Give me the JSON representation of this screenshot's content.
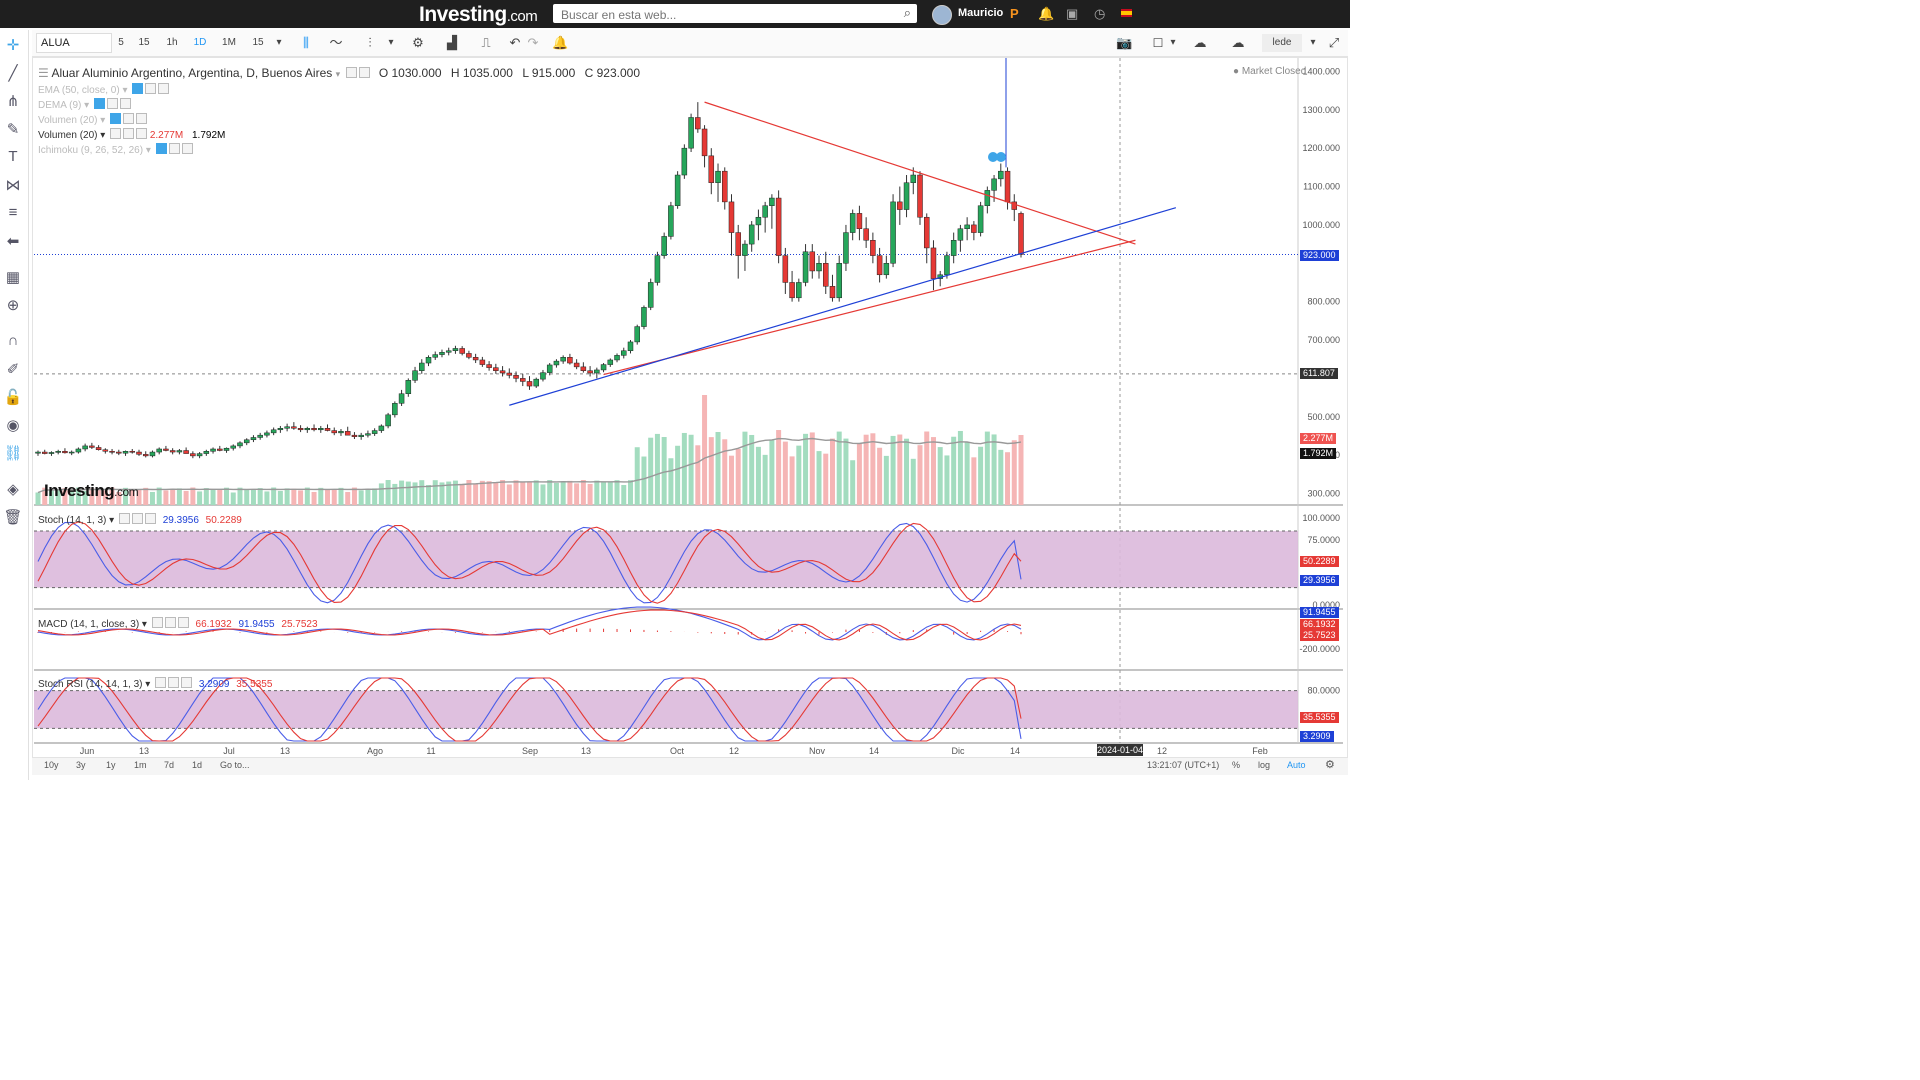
{
  "nav": {
    "logo": "Investing",
    "logo_domain": ".com",
    "search_placeholder": "Buscar en esta web...",
    "username": "Mauricio"
  },
  "toolbar": {
    "symbol": "ALUA",
    "intervals": [
      "5",
      "15",
      "1h",
      "1D",
      "1M",
      "15"
    ],
    "active_interval": "1D",
    "language": "lede"
  },
  "legend": {
    "title": "Aluar Aluminio Argentino, Argentina, D, Buenos Aires",
    "open": "O 1030.000",
    "high": "H 1035.000",
    "low": "L 915.000",
    "close": "C 923.000",
    "ema": "EMA (50, close, 0)",
    "dema": "DEMA (9)",
    "volumen_1": "Volumen (20)",
    "volumen_2": "Volumen (20)",
    "volumen_val1": "2.277M",
    "volumen_val2": "1.792M",
    "ichimoku": "Ichimoku (9, 26, 52, 26)",
    "market_status": "Market Closed"
  },
  "watermark": {
    "text": "Investing",
    "domain": ".com"
  },
  "price_axis": {
    "ticks": [
      "1400.000",
      "1300.000",
      "1200.000",
      "1100.000",
      "1000.000",
      "900.000",
      "800.000",
      "700.000",
      "600.000",
      "500.000",
      "400.000",
      "300.000"
    ],
    "last_price_tag": "923.000",
    "dashed_level_tag": "611.807",
    "volume_tag_1": "2.277M",
    "volume_tag_2": "1.792M"
  },
  "stoch": {
    "label": "Stoch (14, 1, 3)",
    "k": "29.3956",
    "d": "50.2289",
    "axis": [
      "100.0000",
      "75.0000",
      "0.0000"
    ]
  },
  "macd": {
    "label": "MACD (14, 1, close, 3)",
    "v1": "66.1932",
    "v2": "91.9455",
    "v3": "25.7523",
    "axis": [
      "-200.0000"
    ],
    "tag_top": "91.9455"
  },
  "stochrsi": {
    "label": "Stoch RSI (14, 14, 1, 3)",
    "k": "3.2909",
    "d": "35.5355",
    "axis": [
      "80.0000"
    ]
  },
  "time_axis": {
    "labels": [
      "Jun",
      "13",
      "Jul",
      "13",
      "Ago",
      "11",
      "Sep",
      "13",
      "Oct",
      "12",
      "Nov",
      "14",
      "Dic",
      "14",
      "2024-01-04",
      "12",
      "Feb"
    ]
  },
  "bottom": {
    "ranges": [
      "10y",
      "3y",
      "1y",
      "1m",
      "7d",
      "1d",
      "Go to..."
    ],
    "time": "13:21:07 (UTC+1)",
    "pct": "%",
    "log": "log",
    "auto": "Auto"
  },
  "chart_data": {
    "type": "candlestick",
    "title": "Aluar Aluminio Argentino, Argentina, D, Buenos Aires",
    "ylim": [
      270,
      1435
    ],
    "last_close": 923.0,
    "horizontal_level": 611.807,
    "candles": [
      [
        405,
        412,
        398,
        408
      ],
      [
        408,
        414,
        402,
        404
      ],
      [
        404,
        410,
        398,
        407
      ],
      [
        407,
        414,
        402,
        410
      ],
      [
        410,
        418,
        404,
        406
      ],
      [
        406,
        412,
        400,
        408
      ],
      [
        408,
        420,
        404,
        416
      ],
      [
        416,
        430,
        410,
        424
      ],
      [
        424,
        432,
        416,
        420
      ],
      [
        420,
        426,
        412,
        414
      ],
      [
        414,
        418,
        404,
        410
      ],
      [
        410,
        416,
        402,
        408
      ],
      [
        408,
        414,
        400,
        405
      ],
      [
        405,
        412,
        398,
        410
      ],
      [
        410,
        416,
        404,
        408
      ],
      [
        408,
        414,
        398,
        402
      ],
      [
        402,
        410,
        394,
        398
      ],
      [
        398,
        412,
        394,
        408
      ],
      [
        408,
        420,
        402,
        416
      ],
      [
        416,
        424,
        410,
        412
      ],
      [
        412,
        418,
        402,
        408
      ],
      [
        408,
        416,
        402,
        412
      ],
      [
        412,
        420,
        406,
        404
      ],
      [
        404,
        410,
        392,
        398
      ],
      [
        398,
        408,
        392,
        404
      ],
      [
        404,
        414,
        398,
        410
      ],
      [
        410,
        420,
        404,
        416
      ],
      [
        416,
        424,
        410,
        412
      ],
      [
        412,
        420,
        406,
        418
      ],
      [
        418,
        428,
        412,
        424
      ],
      [
        424,
        436,
        418,
        432
      ],
      [
        432,
        444,
        426,
        440
      ],
      [
        440,
        452,
        434,
        446
      ],
      [
        446,
        458,
        440,
        452
      ],
      [
        452,
        464,
        446,
        458
      ],
      [
        458,
        472,
        452,
        466
      ],
      [
        466,
        476,
        458,
        470
      ],
      [
        470,
        482,
        462,
        474
      ],
      [
        474,
        486,
        466,
        470
      ],
      [
        470,
        478,
        460,
        466
      ],
      [
        466,
        474,
        458,
        470
      ],
      [
        470,
        480,
        462,
        466
      ],
      [
        466,
        476,
        458,
        470
      ],
      [
        470,
        480,
        462,
        464
      ],
      [
        464,
        472,
        452,
        458
      ],
      [
        458,
        468,
        450,
        462
      ],
      [
        462,
        474,
        456,
        452
      ],
      [
        452,
        460,
        442,
        448
      ],
      [
        448,
        458,
        440,
        452
      ],
      [
        452,
        464,
        446,
        456
      ],
      [
        456,
        470,
        450,
        464
      ],
      [
        464,
        480,
        458,
        476
      ],
      [
        476,
        510,
        470,
        505
      ],
      [
        505,
        540,
        498,
        535
      ],
      [
        535,
        570,
        528,
        560
      ],
      [
        560,
        600,
        552,
        595
      ],
      [
        595,
        630,
        588,
        620
      ],
      [
        620,
        650,
        612,
        640
      ],
      [
        640,
        660,
        632,
        655
      ],
      [
        655,
        670,
        648,
        662
      ],
      [
        662,
        675,
        655,
        668
      ],
      [
        668,
        680,
        660,
        672
      ],
      [
        672,
        685,
        664,
        678
      ],
      [
        678,
        684,
        660,
        665
      ],
      [
        665,
        672,
        650,
        655
      ],
      [
        655,
        664,
        640,
        648
      ],
      [
        648,
        656,
        630,
        636
      ],
      [
        636,
        645,
        620,
        628
      ],
      [
        628,
        638,
        612,
        620
      ],
      [
        620,
        632,
        605,
        614
      ],
      [
        614,
        626,
        600,
        608
      ],
      [
        608,
        618,
        590,
        600
      ],
      [
        600,
        612,
        580,
        592
      ],
      [
        592,
        606,
        570,
        580
      ],
      [
        580,
        602,
        575,
        598
      ],
      [
        598,
        622,
        592,
        615
      ],
      [
        615,
        640,
        608,
        635
      ],
      [
        635,
        650,
        628,
        645
      ],
      [
        645,
        660,
        638,
        655
      ],
      [
        655,
        664,
        636,
        640
      ],
      [
        640,
        650,
        624,
        630
      ],
      [
        630,
        642,
        615,
        620
      ],
      [
        620,
        632,
        605,
        614
      ],
      [
        614,
        628,
        600,
        622
      ],
      [
        622,
        640,
        616,
        636
      ],
      [
        636,
        652,
        630,
        648
      ],
      [
        648,
        665,
        642,
        660
      ],
      [
        660,
        680,
        652,
        672
      ],
      [
        672,
        700,
        665,
        695
      ],
      [
        695,
        740,
        688,
        735
      ],
      [
        735,
        790,
        728,
        785
      ],
      [
        785,
        860,
        778,
        850
      ],
      [
        850,
        930,
        842,
        920
      ],
      [
        920,
        980,
        912,
        970
      ],
      [
        970,
        1060,
        962,
        1050
      ],
      [
        1050,
        1140,
        1042,
        1130
      ],
      [
        1130,
        1210,
        1120,
        1200
      ],
      [
        1200,
        1290,
        1190,
        1280
      ],
      [
        1280,
        1320,
        1240,
        1250
      ],
      [
        1250,
        1260,
        1150,
        1180
      ],
      [
        1180,
        1200,
        1080,
        1110
      ],
      [
        1110,
        1160,
        1060,
        1140
      ],
      [
        1140,
        1150,
        1040,
        1060
      ],
      [
        1060,
        1080,
        920,
        980
      ],
      [
        980,
        1000,
        860,
        920
      ],
      [
        920,
        960,
        880,
        950
      ],
      [
        950,
        1010,
        930,
        1000
      ],
      [
        1000,
        1040,
        960,
        1020
      ],
      [
        1020,
        1060,
        980,
        1050
      ],
      [
        1050,
        1080,
        990,
        1070
      ],
      [
        1070,
        1090,
        900,
        920
      ],
      [
        920,
        940,
        820,
        850
      ],
      [
        850,
        880,
        800,
        810
      ],
      [
        810,
        860,
        800,
        850
      ],
      [
        850,
        950,
        840,
        930
      ],
      [
        930,
        950,
        860,
        880
      ],
      [
        880,
        920,
        860,
        900
      ],
      [
        900,
        930,
        820,
        840
      ],
      [
        840,
        870,
        800,
        810
      ],
      [
        810,
        920,
        800,
        900
      ],
      [
        900,
        1000,
        880,
        980
      ],
      [
        980,
        1040,
        960,
        1030
      ],
      [
        1030,
        1050,
        960,
        990
      ],
      [
        990,
        1020,
        940,
        960
      ],
      [
        960,
        980,
        900,
        920
      ],
      [
        920,
        940,
        850,
        870
      ],
      [
        870,
        920,
        860,
        900
      ],
      [
        900,
        1080,
        890,
        1060
      ],
      [
        1060,
        1100,
        1000,
        1040
      ],
      [
        1040,
        1130,
        1020,
        1110
      ],
      [
        1110,
        1150,
        1080,
        1130
      ],
      [
        1130,
        1140,
        1000,
        1020
      ],
      [
        1020,
        1030,
        900,
        940
      ],
      [
        940,
        960,
        830,
        860
      ],
      [
        860,
        880,
        840,
        870
      ],
      [
        870,
        930,
        860,
        920
      ],
      [
        920,
        980,
        900,
        960
      ],
      [
        960,
        1000,
        930,
        990
      ],
      [
        990,
        1020,
        960,
        1000
      ],
      [
        1000,
        1010,
        960,
        980
      ],
      [
        980,
        1060,
        970,
        1050
      ],
      [
        1050,
        1100,
        1030,
        1090
      ],
      [
        1090,
        1130,
        1060,
        1120
      ],
      [
        1120,
        1160,
        1100,
        1140
      ],
      [
        1140,
        1150,
        1040,
        1060
      ],
      [
        1060,
        1080,
        1010,
        1040
      ],
      [
        1030,
        1035,
        915,
        923
      ]
    ],
    "volume_ratio_scale": "relative",
    "trendlines": [
      {
        "color": "#e53935",
        "desc": "descending resistance"
      },
      {
        "color": "#e53935",
        "desc": "ascending support"
      },
      {
        "color": "#1e40d6",
        "desc": "ascending support"
      }
    ]
  }
}
